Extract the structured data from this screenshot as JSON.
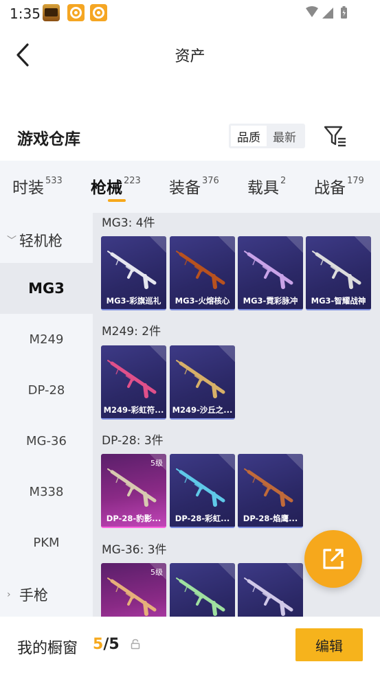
{
  "status_bar": {
    "time": "1:35",
    "icons": [
      "game-app-icon",
      "orange-app-icon",
      "orange-app-icon",
      "wifi-icon",
      "signal-icon",
      "battery-icon"
    ]
  },
  "header": {
    "title": "资产",
    "back_icon": "back-arrow-icon"
  },
  "warehouse": {
    "title": "游戏仓库",
    "sort": {
      "options": [
        "品质",
        "最新"
      ],
      "selected": "品质"
    },
    "filter_icon": "filter-icon"
  },
  "tabs": [
    {
      "label": "时装",
      "count": "533"
    },
    {
      "label": "枪械",
      "count": "223",
      "active": true
    },
    {
      "label": "装备",
      "count": "376"
    },
    {
      "label": "载具",
      "count": "2"
    },
    {
      "label": "战备",
      "count": "179"
    }
  ],
  "nav": {
    "group_open": "轻机枪",
    "items": [
      "MG3",
      "M249",
      "DP-28",
      "MG-36",
      "M338",
      "PKM"
    ],
    "active": "MG3",
    "group_closed": "手枪"
  },
  "groups": [
    {
      "title": "MG3: 4件",
      "items": [
        {
          "name": "MG3-彩旗巡礼",
          "level": "",
          "tier": "purple",
          "gun": "#e6e6ef"
        },
        {
          "name": "MG3-火熔核心",
          "level": "",
          "tier": "purple",
          "gun": "#b8521f"
        },
        {
          "name": "MG3-霓彩脉冲",
          "level": "",
          "tier": "purple",
          "gun": "#c9a3e8"
        },
        {
          "name": "MG3-智耀战神",
          "level": "",
          "tier": "purple",
          "gun": "#dcdcdc"
        }
      ]
    },
    {
      "title": "M249: 2件",
      "items": [
        {
          "name": "M249-彩虹符...",
          "level": "",
          "tier": "purple",
          "gun": "#e0508a"
        },
        {
          "name": "M249-沙丘之...",
          "level": "",
          "tier": "purple",
          "gun": "#d7b068"
        }
      ]
    },
    {
      "title": "DP-28: 3件",
      "items": [
        {
          "name": "DP-28-豹影...",
          "level": "5级",
          "tier": "pink",
          "gun": "#d8c9b0"
        },
        {
          "name": "DP-28-彩虹...",
          "level": "",
          "tier": "purple",
          "gun": "#5fc9e8"
        },
        {
          "name": "DP-28-焰鹰...",
          "level": "",
          "tier": "purple",
          "gun": "#c06a3a"
        }
      ]
    },
    {
      "title": "MG-36: 3件",
      "items": [
        {
          "name": "",
          "level": "5级",
          "tier": "pink",
          "gun": "#e6b07a"
        },
        {
          "name": "",
          "level": "",
          "tier": "purple",
          "gun": "#9fe0a0"
        },
        {
          "name": "",
          "level": "",
          "tier": "purple",
          "gun": "#d0c8e8"
        }
      ]
    }
  ],
  "fab_icon": "share-external-icon",
  "showcase": {
    "label": "我的橱窗",
    "current": "5",
    "separator": "/",
    "max": "5",
    "lock_icon": "lock-icon",
    "edit_label": "编辑"
  },
  "colors": {
    "accent": "#f6a81c",
    "card_purple": "#2e2b6c",
    "card_pink": "#a8369e"
  }
}
